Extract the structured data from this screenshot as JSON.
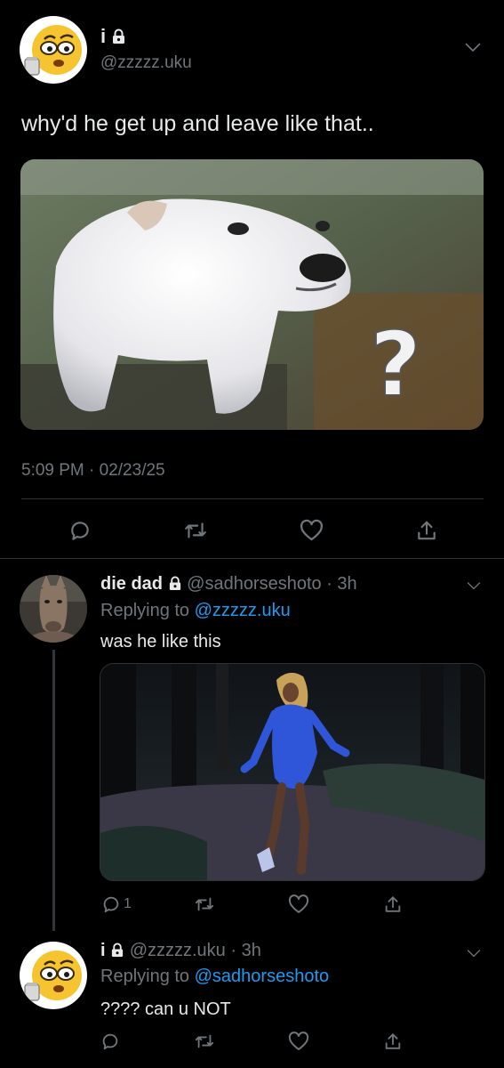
{
  "main_tweet": {
    "author_name": "i",
    "handle": "@zzzzz.uku",
    "text": "why'd he get up and leave like that..",
    "timestamp": "5:09 PM · 02/23/25",
    "image_overlay_text": "?",
    "icons": [
      "lock-icon",
      "chevron-down-icon",
      "reply-icon",
      "retweet-icon",
      "like-icon",
      "share-icon"
    ]
  },
  "reply1": {
    "author_name": "die dad",
    "handle": "@sadhorseshoto",
    "time": "· 3h",
    "replying_label": "Replying to",
    "replying_to": "@zzzzz.uku",
    "text": "was he like this",
    "reply_count": "1"
  },
  "reply2": {
    "author_name": "i",
    "handle": "@zzzzz.uku",
    "time": "· 3h",
    "replying_label": "Replying to",
    "replying_to": "@sadhorseshoto",
    "text": "???? can u NOT"
  },
  "colors": {
    "background": "#000000",
    "text": "#e7e9ea",
    "muted": "#71767b",
    "link": "#1d9bf0",
    "divider": "#2f3336"
  }
}
